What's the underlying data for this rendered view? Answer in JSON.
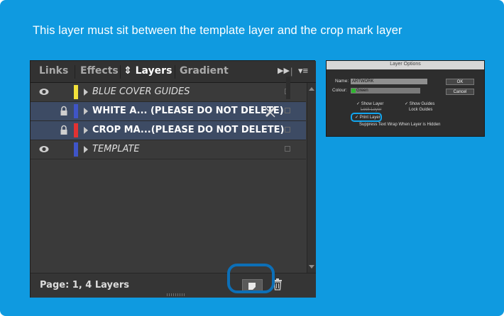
{
  "headline": "This layer must sit between the template layer and the crop mark layer",
  "panel": {
    "tabs": [
      {
        "label": "Links"
      },
      {
        "label": "Effects"
      },
      {
        "label": "⇕ Layers"
      },
      {
        "label": "Gradient"
      }
    ],
    "layers": [
      {
        "name": "BLUE COVER GUIDES",
        "visible": true,
        "locked": false,
        "color": "#f2e13b",
        "selected": false
      },
      {
        "name": "WHITE A... (PLEASE DO NOT DELETE)",
        "visible": false,
        "locked": true,
        "color": "#3f55c8",
        "selected": true,
        "pen_icon": true
      },
      {
        "name": "CROP MA...(PLEASE DO NOT DELETE)",
        "visible": false,
        "locked": true,
        "color": "#e23232",
        "selected": true
      },
      {
        "name": "TEMPLATE",
        "visible": true,
        "locked": false,
        "color": "#3f55c8",
        "selected": false
      }
    ],
    "footer_text": "Page: 1, 4 Layers"
  },
  "dialog": {
    "title": "Layer Options",
    "name_label": "Name:",
    "name_value": "ARTWORK",
    "colour_label": "Colour:",
    "colour_value": "Green",
    "ok_label": "OK",
    "cancel_label": "Cancel",
    "show_layer": "Show Layer",
    "show_guides": "Show Guides",
    "lock_layer": "Lock Layer",
    "lock_guides": "Lock Guides",
    "print_layer": "Print Layer",
    "suppress": "Suppress Text Wrap When Layer is Hidden"
  },
  "colors": {
    "background": "#0f9ae0",
    "panel": "#3a3a3a",
    "highlight_ring": "#0c6fb7"
  },
  "icons": {
    "eye": "eye-icon",
    "lock": "lock-icon",
    "new_layer": "new-layer-icon",
    "trash": "trash-icon",
    "pen": "pen-icon",
    "fast_forward": "fast-forward-icon",
    "panel_menu": "panel-menu-icon"
  }
}
